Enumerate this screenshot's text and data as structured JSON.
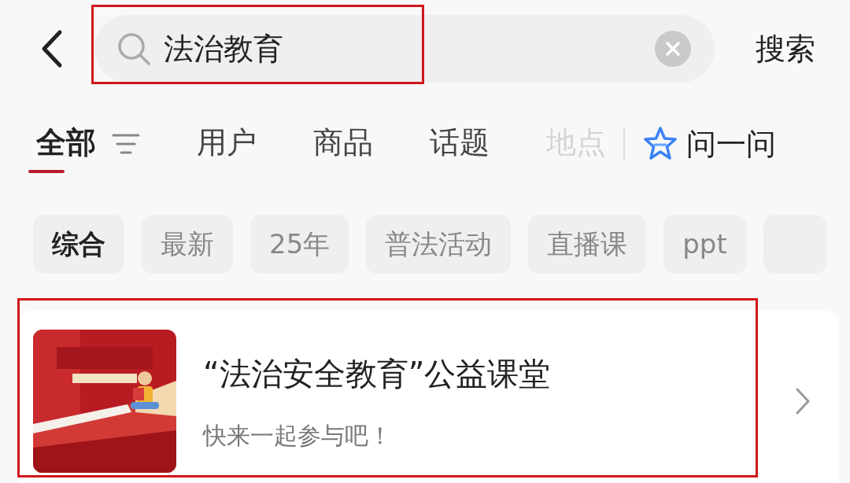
{
  "search": {
    "value": "法治教育",
    "button": "搜索"
  },
  "tabs": [
    {
      "label": "全部",
      "selected": true,
      "faded": false
    },
    {
      "label": "用户",
      "selected": false,
      "faded": false
    },
    {
      "label": "商品",
      "selected": false,
      "faded": false
    },
    {
      "label": "话题",
      "selected": false,
      "faded": false
    },
    {
      "label": "地点",
      "selected": false,
      "faded": true
    }
  ],
  "ask": {
    "label": "问一问"
  },
  "chips": [
    {
      "label": "综合",
      "selected": true
    },
    {
      "label": "最新",
      "selected": false
    },
    {
      "label": "25年",
      "selected": false
    },
    {
      "label": "普法活动",
      "selected": false
    },
    {
      "label": "直播课",
      "selected": false
    },
    {
      "label": "ppt",
      "selected": false
    }
  ],
  "result": {
    "title": "“法治安全教育”公益课堂",
    "subtitle": "快来一起参与吧！"
  }
}
